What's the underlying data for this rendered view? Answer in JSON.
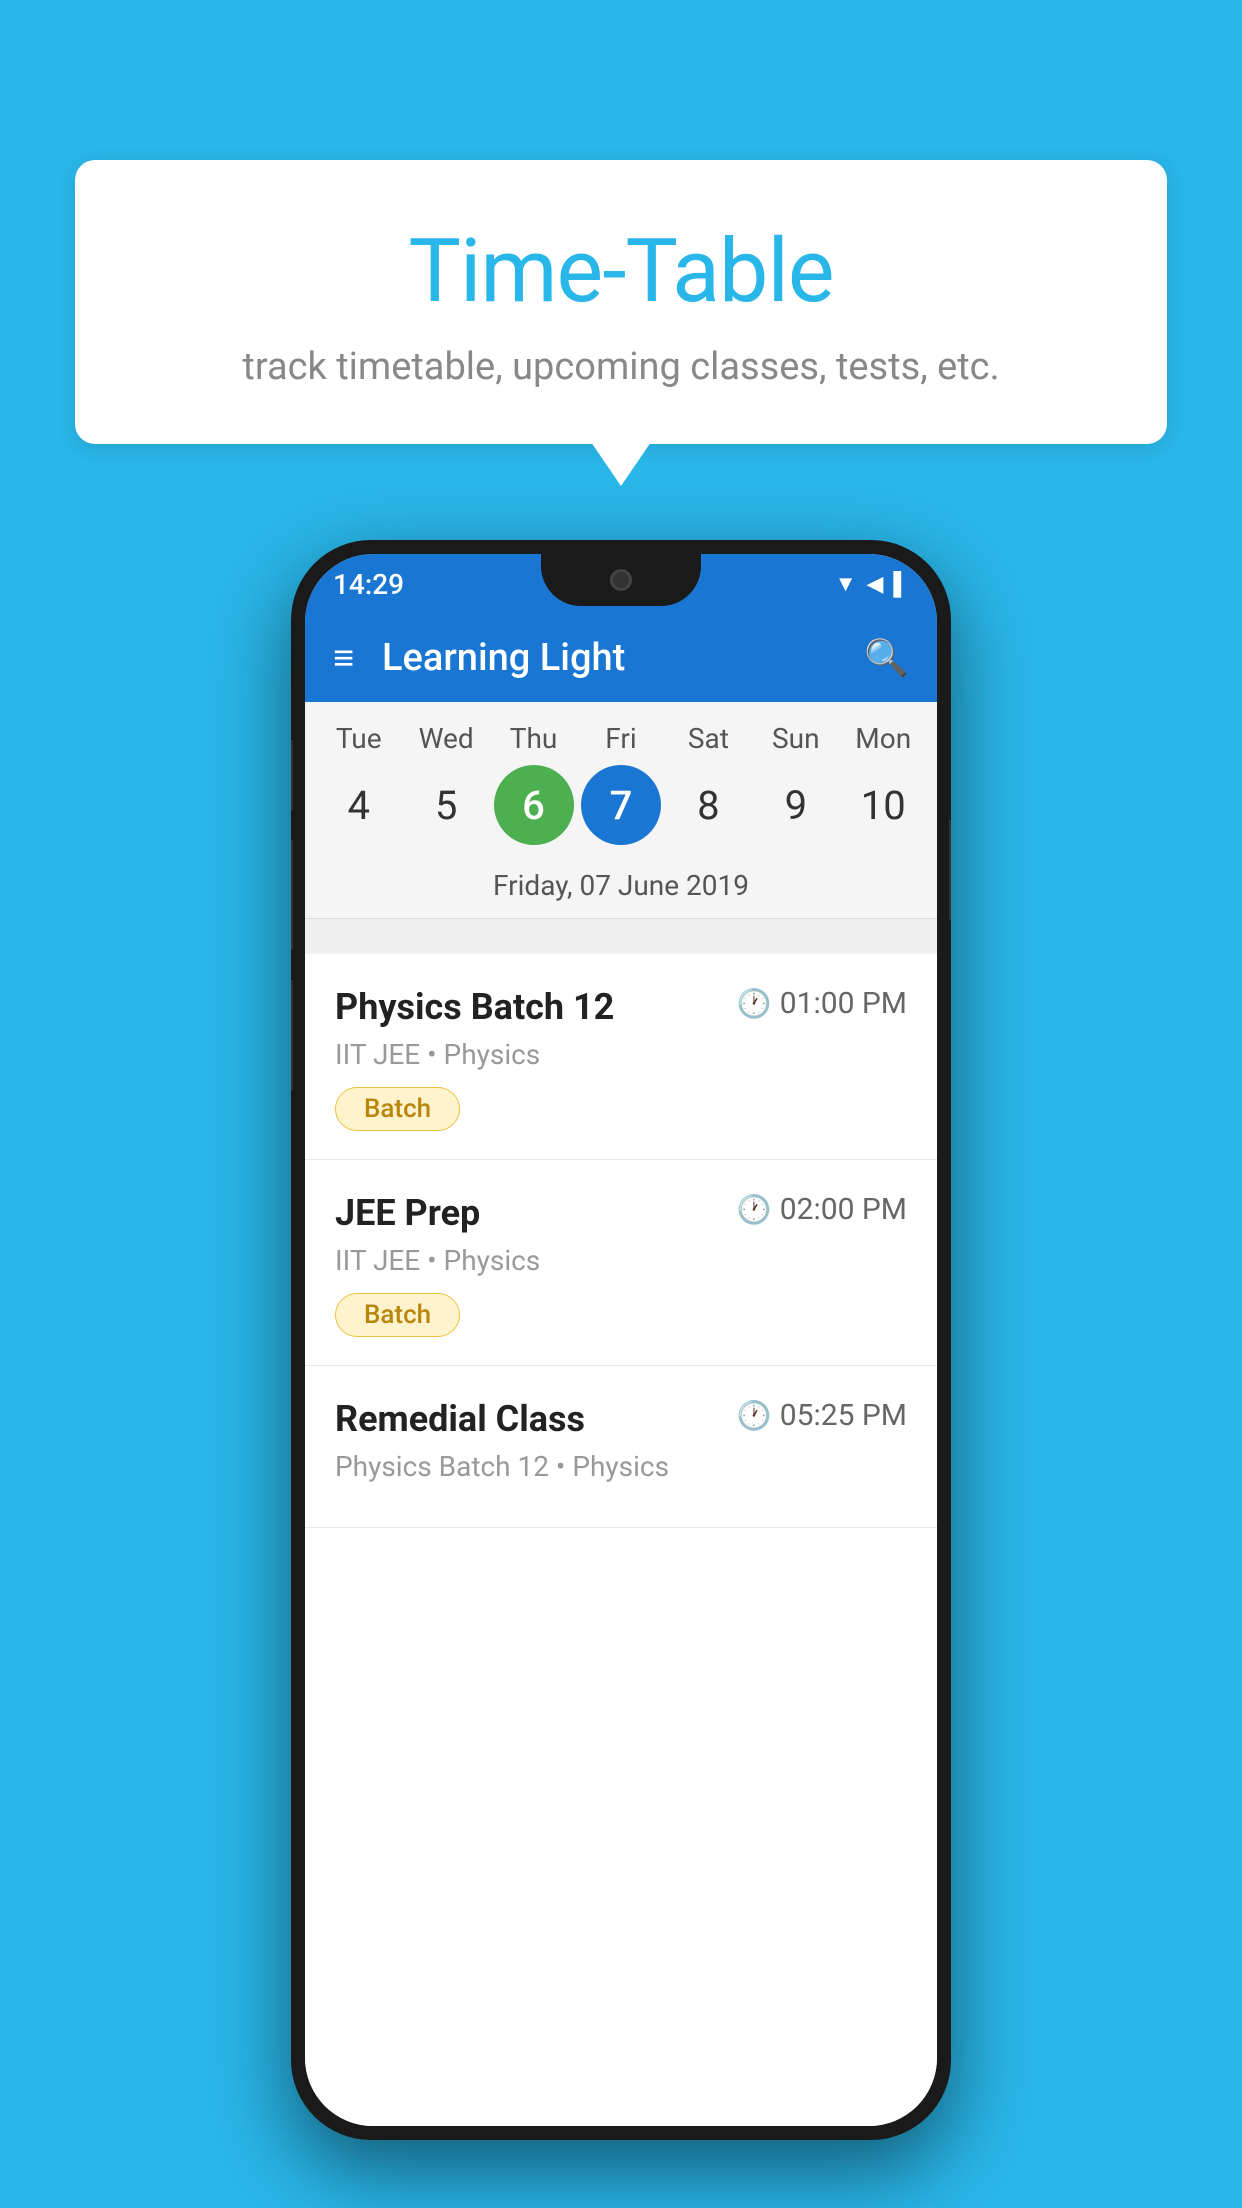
{
  "background_color": "#29B6E8",
  "speech_bubble": {
    "title": "Time-Table",
    "subtitle": "track timetable, upcoming classes, tests, etc."
  },
  "phone": {
    "status_bar": {
      "time": "14:29",
      "icons": [
        "▼",
        "◀",
        "▌"
      ]
    },
    "app_bar": {
      "title": "Learning Light",
      "menu_icon": "≡",
      "search_icon": "🔍"
    },
    "calendar": {
      "days": [
        {
          "label": "Tue",
          "num": "4"
        },
        {
          "label": "Wed",
          "num": "5"
        },
        {
          "label": "Thu",
          "num": "6",
          "state": "today"
        },
        {
          "label": "Fri",
          "num": "7",
          "state": "selected"
        },
        {
          "label": "Sat",
          "num": "8"
        },
        {
          "label": "Sun",
          "num": "9"
        },
        {
          "label": "Mon",
          "num": "10"
        }
      ],
      "selected_date_label": "Friday, 07 June 2019"
    },
    "schedule": [
      {
        "title": "Physics Batch 12",
        "time": "01:00 PM",
        "subtitle": "IIT JEE • Physics",
        "badge": "Batch"
      },
      {
        "title": "JEE Prep",
        "time": "02:00 PM",
        "subtitle": "IIT JEE • Physics",
        "badge": "Batch"
      },
      {
        "title": "Remedial Class",
        "time": "05:25 PM",
        "subtitle": "Physics Batch 12 • Physics",
        "badge": null
      }
    ]
  }
}
